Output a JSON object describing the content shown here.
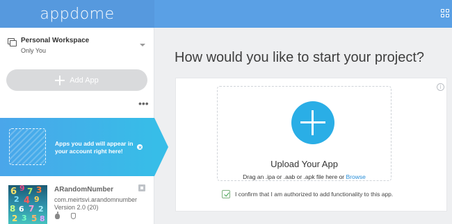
{
  "header": {
    "logo": "appdome",
    "apps_icon": "grid-icon"
  },
  "sidebar": {
    "workspace": {
      "title": "Personal Workspace",
      "subtitle": "Only You",
      "icon": "workspace-icon"
    },
    "add_app_label": "Add App",
    "more_label": "•••",
    "banner_text": "Apps you add will appear in your account right here!",
    "apps": [
      {
        "name": "ARandomNumber",
        "bundle": "com.meirtsvi.arandomnumber",
        "version": "Version 2.0 (20)",
        "platform_icon": "apple-icon",
        "status_icon": "shield-icon"
      }
    ]
  },
  "main": {
    "heading": "How would you like to start your project?",
    "upload": {
      "title": "Upload Your App",
      "drag_text": "Drag an .ipa or .aab or .apk file here or ",
      "browse_label": "Browse"
    },
    "confirm_text": "I confirm that I am authorized to add functionality to this app.",
    "confirm_checked": true,
    "info_icon_glyph": "i"
  },
  "colors": {
    "topbar": "#5aa0e5",
    "accent": "#2aaee6",
    "banner": "#3fb3e9",
    "link": "#2a8fd9"
  }
}
